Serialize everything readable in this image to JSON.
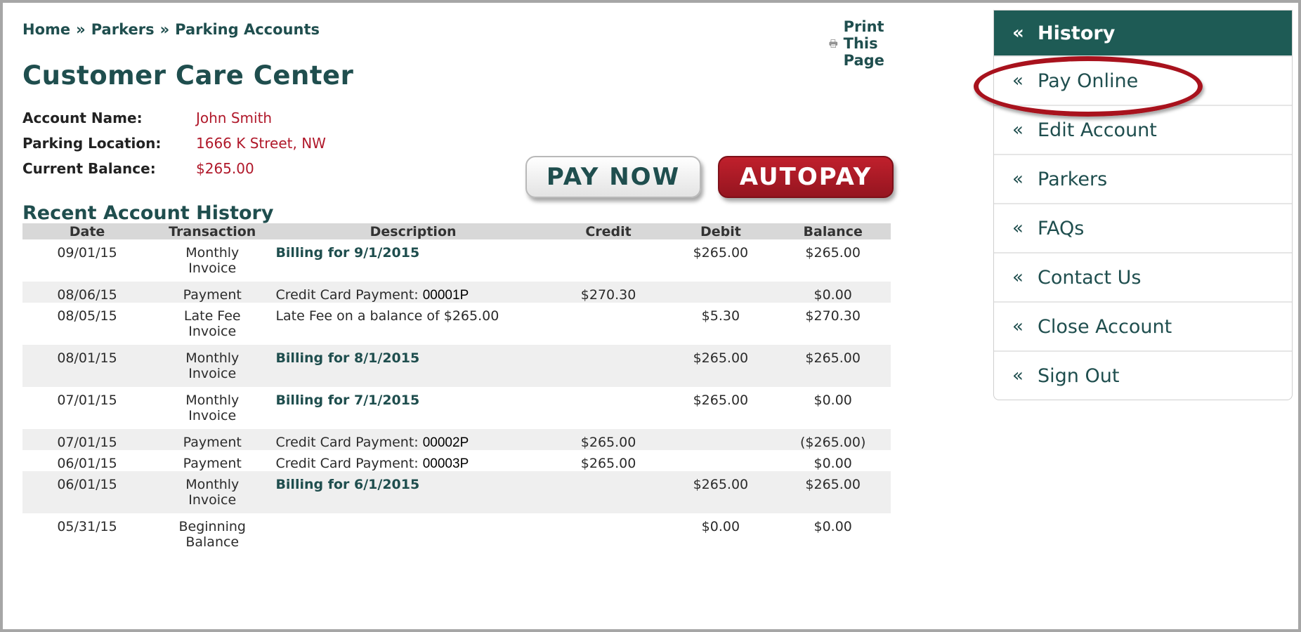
{
  "breadcrumb": [
    "Home",
    "Parkers",
    "Parking Accounts"
  ],
  "breadcrumb_separator": "»",
  "print_label": "Print This Page",
  "page_title": "Customer Care Center",
  "account": {
    "name_label": "Account Name:",
    "name_value": "John Smith",
    "location_label": "Parking Location:",
    "location_value": "1666 K Street, NW",
    "balance_label": "Current Balance:",
    "balance_value": "$265.00"
  },
  "buttons": {
    "pay_now": "PAY NOW",
    "autopay": "AUTOPAY"
  },
  "history": {
    "title": "Recent Account History",
    "columns": [
      "Date",
      "Transaction",
      "Description",
      "Credit",
      "Debit",
      "Balance"
    ],
    "rows": [
      {
        "date": "09/01/15",
        "trans1": "Monthly",
        "trans2": "Invoice",
        "desc": "Billing for 9/1/2015",
        "ref": "",
        "credit": "",
        "debit": "$265.00",
        "balance": "$265.00"
      },
      {
        "date": "08/06/15",
        "trans1": "Payment",
        "trans2": "",
        "desc": "Credit Card Payment:",
        "ref": "00001P",
        "credit": "$270.30",
        "debit": "",
        "balance": "$0.00"
      },
      {
        "date": "08/05/15",
        "trans1": "Late Fee",
        "trans2": "Invoice",
        "desc": "Late Fee on a balance of $265.00",
        "ref": "",
        "credit": "",
        "debit": "$5.30",
        "balance": "$270.30"
      },
      {
        "date": "08/01/15",
        "trans1": "Monthly",
        "trans2": "Invoice",
        "desc": "Billing for 8/1/2015",
        "ref": "",
        "credit": "",
        "debit": "$265.00",
        "balance": "$265.00"
      },
      {
        "date": "07/01/15",
        "trans1": "Monthly",
        "trans2": "Invoice",
        "desc": "Billing for 7/1/2015",
        "ref": "",
        "credit": "",
        "debit": "$265.00",
        "balance": "$0.00"
      },
      {
        "date": "07/01/15",
        "trans1": "Payment",
        "trans2": "",
        "desc": "Credit Card Payment:",
        "ref": "00002P",
        "credit": "$265.00",
        "debit": "",
        "balance": "($265.00)"
      },
      {
        "date": "06/01/15",
        "trans1": "Payment",
        "trans2": "",
        "desc": "Credit Card Payment:",
        "ref": "00003P",
        "credit": "$265.00",
        "debit": "",
        "balance": "$0.00"
      },
      {
        "date": "06/01/15",
        "trans1": "Monthly",
        "trans2": "Invoice",
        "desc": "Billing for 6/1/2015",
        "ref": "",
        "credit": "",
        "debit": "$265.00",
        "balance": "$265.00"
      },
      {
        "date": "05/31/15",
        "trans1": "Beginning",
        "trans2": "Balance",
        "desc": "",
        "ref": "",
        "credit": "",
        "debit": "$0.00",
        "balance": "$0.00"
      }
    ]
  },
  "sidebar": {
    "chevron": "«",
    "items": [
      "History",
      "Pay Online",
      "Edit Account",
      "Parkers",
      "FAQs",
      "Contact Us",
      "Close Account",
      "Sign Out"
    ]
  },
  "colors": {
    "brand_green": "#1f4e4e",
    "sidebar_active": "#1e5b55",
    "accent_red": "#b0182a",
    "highlight_oval": "#a8121d"
  },
  "icons": {
    "print": "printer-icon",
    "chevron": "double-chevron-left-icon"
  }
}
